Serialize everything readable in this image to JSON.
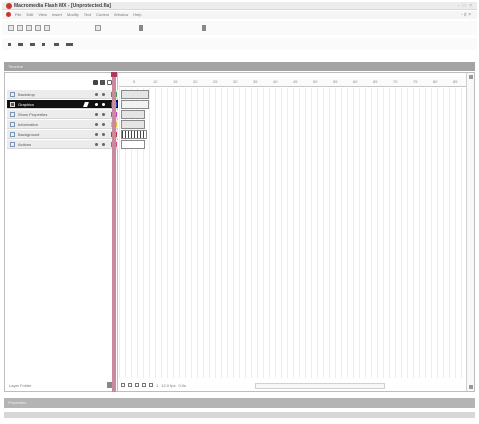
{
  "window": {
    "title": "Macromedia Flash MX - [Unprotected.fla]",
    "controls": "- □ ×"
  },
  "menubar": {
    "items": [
      "File",
      "Edit",
      "View",
      "Insert",
      "Modify",
      "Text",
      "Control",
      "Window",
      "Help"
    ],
    "right": "- ♯ ×"
  },
  "timeline": {
    "panel_title": "Timeline",
    "layers": [
      {
        "name": "Backdrop"
      },
      {
        "name": "Graphics"
      },
      {
        "name": "Show Properties"
      },
      {
        "name": "Information"
      },
      {
        "name": "Background"
      },
      {
        "name": "Actions"
      }
    ],
    "ruler_labels": [
      "5",
      "10",
      "15",
      "20",
      "25",
      "30",
      "35",
      "40",
      "45",
      "50",
      "55",
      "60",
      "65",
      "70",
      "75",
      "80",
      "85"
    ],
    "footer_left": "Layer Folder",
    "current_frame": "1",
    "fps": "12.0 fps",
    "elapsed": "0.0s"
  },
  "bottom_panel": {
    "label": "Properties"
  },
  "colors": {
    "accent": "#c8382d",
    "playhead": "#b03a5b",
    "selection": "#111111"
  }
}
